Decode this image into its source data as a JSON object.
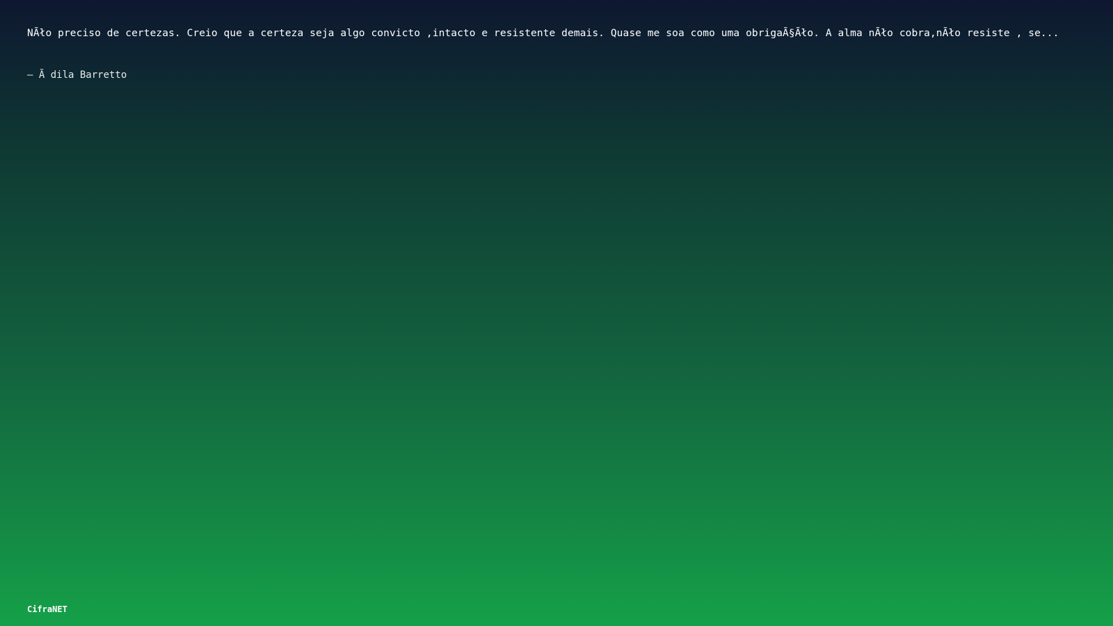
{
  "quote": {
    "text": "NÃło preciso de certezas. Creio que a certeza seja algo convicto ,intacto e resistente demais. Quase me soa como uma obrigaÃ§Ãło. A alma nÃło cobra,nÃło resiste , se...",
    "author": "– Ã dila Barretto"
  },
  "brand": {
    "label": "CifraNET"
  },
  "colors": {
    "background_top": "#0e1730",
    "background_bottom": "#15a048",
    "text": "#ffffff"
  }
}
